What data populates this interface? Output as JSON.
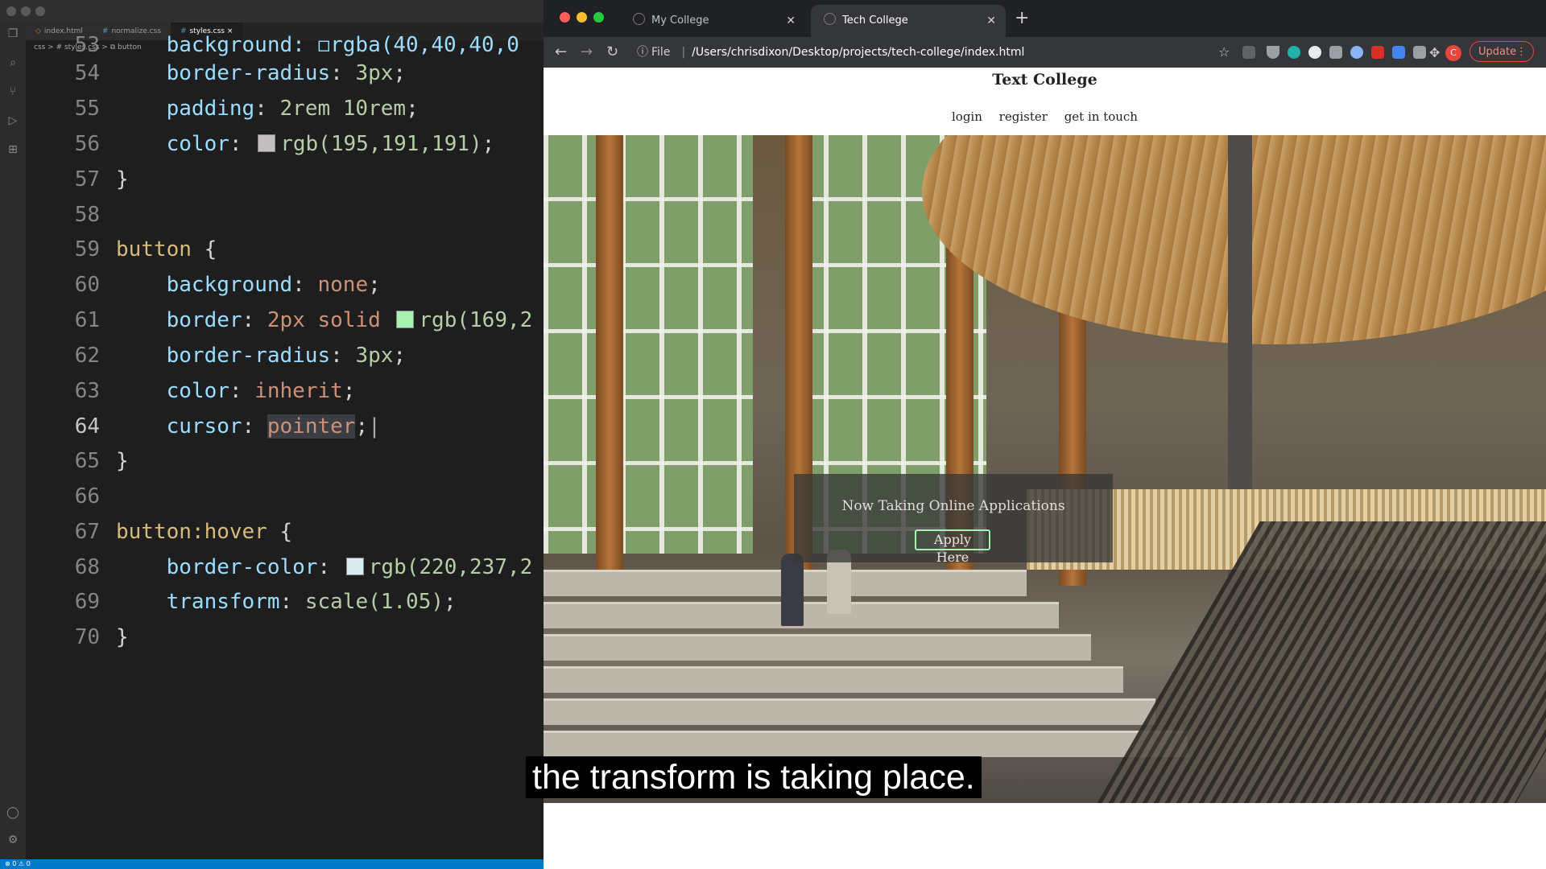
{
  "vscode": {
    "tabs": [
      {
        "label": "index.html",
        "kind": "html"
      },
      {
        "label": "normalize.css",
        "kind": "css"
      },
      {
        "label": "styles.css",
        "kind": "css",
        "active": true
      }
    ],
    "breadcrumb": "css > # styles.css > ⧉ button",
    "code_lines": [
      {
        "n": "53",
        "text": "    background: ◻rgba(40,40,40,0"
      },
      {
        "n": "54",
        "prop": "border-radius",
        "value": "3px"
      },
      {
        "n": "55",
        "prop": "padding",
        "value": "2rem 10rem"
      },
      {
        "n": "56",
        "prop": "color",
        "value": "rgb(195,191,191)"
      },
      {
        "n": "57",
        "text": "}"
      },
      {
        "n": "58",
        "text": ""
      },
      {
        "n": "59",
        "selector": "button"
      },
      {
        "n": "60",
        "prop": "background",
        "value": "none"
      },
      {
        "n": "61",
        "prop": "border",
        "value": "rgb(169,2"
      },
      {
        "n": "62",
        "prop": "border-radius",
        "value": "3px"
      },
      {
        "n": "63",
        "prop": "color",
        "value": "inherit"
      },
      {
        "n": "64",
        "prop": "cursor",
        "value": "pointer"
      },
      {
        "n": "65",
        "text": "}"
      },
      {
        "n": "66",
        "text": ""
      },
      {
        "n": "67",
        "selector": "button:hover"
      },
      {
        "n": "68",
        "prop": "border-color",
        "value": "rgb(220,237,2"
      },
      {
        "n": "69",
        "prop": "transform",
        "value": "scale(1.05)"
      },
      {
        "n": "70",
        "text": "}"
      }
    ],
    "line61_prefix": "2px solid",
    "swatches": {
      "color56": "#c3bfbf",
      "border61": "#a9f0b3",
      "hover68": "#dcedf2"
    },
    "status": "⊗ 0 ⚠ 0"
  },
  "chrome": {
    "tabs": [
      {
        "label": "My College",
        "active": false
      },
      {
        "label": "Tech College",
        "active": true
      }
    ],
    "omnibox": {
      "scheme": "File",
      "url": "/Users/chrisdixon/Desktop/projects/tech-college/index.html"
    },
    "profile_initial": "C",
    "update_label": "Update",
    "colors": {
      "close": "#ff5f57",
      "minimize": "#febc2e",
      "maximize": "#28c840"
    }
  },
  "site": {
    "title": "Text College",
    "nav": [
      "login",
      "register",
      "get in touch"
    ],
    "tagline": "Now Taking Online Applications",
    "button": "Apply Here"
  },
  "caption": "the transform is taking place."
}
